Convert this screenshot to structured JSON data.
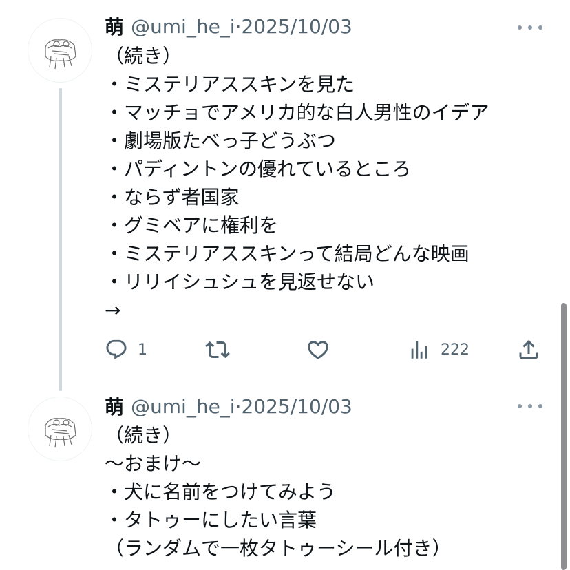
{
  "tweets": [
    {
      "author_name": "萌",
      "handle": "@umi_he_i",
      "separator": "·",
      "date": "2025/10/03",
      "lines": [
        "（続き）",
        "・ミステリアススキンを見た",
        "・マッチョでアメリカ的な白人男性のイデア",
        "・劇場版たべっ子どうぶつ",
        "・パディントンの優れているところ",
        "・ならず者国家",
        "・グミベアに権利を",
        "・ミステリアススキンって結局どんな映画",
        "・リリイシュシュを見返せない",
        "→"
      ],
      "reply_count": "1",
      "view_count": "222"
    },
    {
      "author_name": "萌",
      "handle": "@umi_he_i",
      "separator": "·",
      "date": "2025/10/03",
      "lines": [
        "（続き）",
        "〜おまけ〜",
        "・犬に名前をつけてみよう",
        "・タトゥーにしたい言葉",
        "（ランダムで一枚タトゥーシール付き）"
      ]
    }
  ],
  "icons": {
    "avatar": "sketch-avatar-icon",
    "more": "more-dots-icon",
    "reply": "reply-icon",
    "retweet": "retweet-icon",
    "like": "heart-icon",
    "views": "analytics-icon",
    "share": "share-icon"
  },
  "colors": {
    "text": "#0f1419",
    "secondary": "#536471",
    "thread_line": "#cfd9de"
  }
}
